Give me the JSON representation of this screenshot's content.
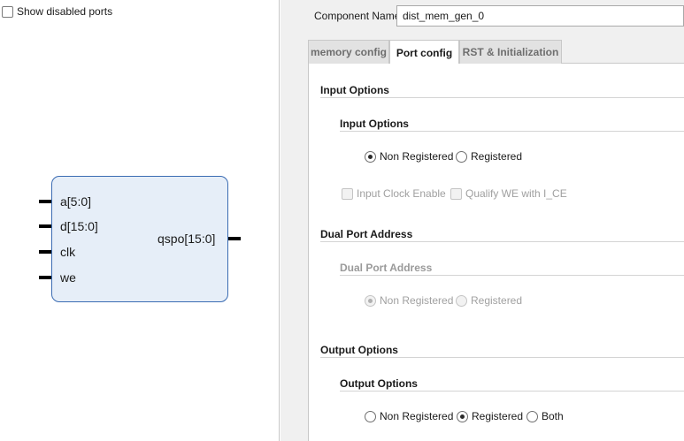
{
  "left_panel": {
    "show_disabled_ports_label": "Show disabled ports",
    "show_disabled_ports_checked": false,
    "symbol": {
      "inputs": [
        "a[5:0]",
        "d[15:0]",
        "clk",
        "we"
      ],
      "output": "qspo[15:0]"
    }
  },
  "header": {
    "component_name_label": "Component Name",
    "component_name_value": "dist_mem_gen_0"
  },
  "tabs": [
    {
      "label": "memory config",
      "active": false
    },
    {
      "label": "Port config",
      "active": true
    },
    {
      "label": "RST & Initialization",
      "active": false
    }
  ],
  "input_options": {
    "title": "Input Options",
    "subtitle": "Input Options",
    "radio_non_registered": "Non Registered",
    "radio_registered": "Registered",
    "selected": "Non Registered",
    "input_clock_enable": "Input Clock Enable",
    "qualify_we": "Qualify WE with I_CE"
  },
  "dual_port_address": {
    "title": "Dual Port Address",
    "subtitle": "Dual Port Address",
    "radio_non_registered": "Non Registered",
    "radio_registered": "Registered",
    "selected": "Non Registered",
    "enabled": false
  },
  "output_options": {
    "title": "Output Options",
    "subtitle": "Output Options",
    "radio_non_registered": "Non Registered",
    "radio_registered": "Registered",
    "radio_both": "Both",
    "selected": "Registered"
  }
}
